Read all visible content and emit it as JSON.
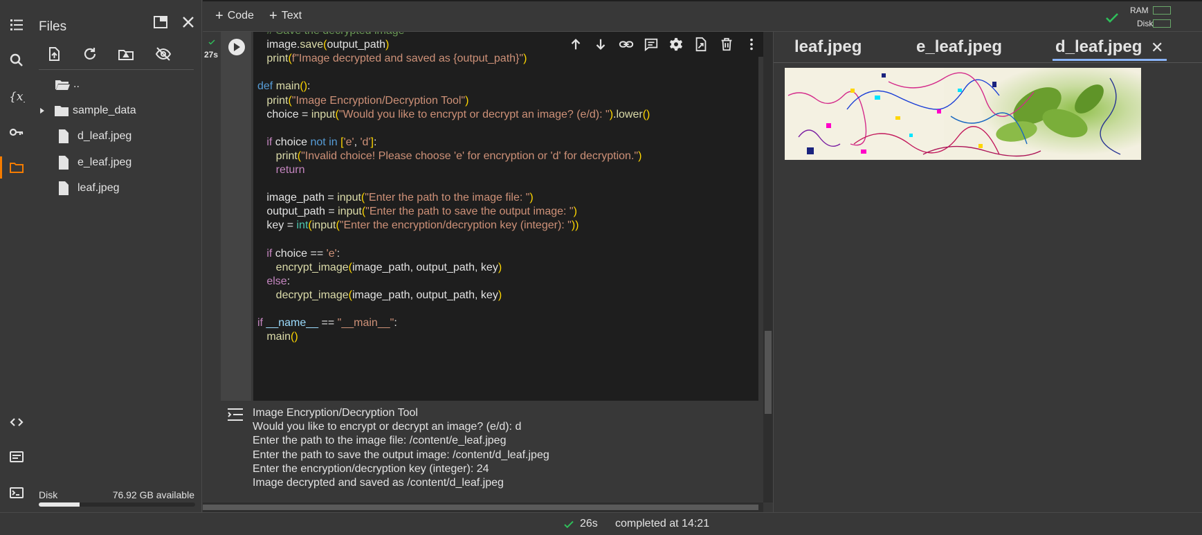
{
  "files_panel": {
    "title": "Files",
    "tree": [
      {
        "name": "..",
        "type": "parent"
      },
      {
        "name": "sample_data",
        "type": "folder"
      },
      {
        "name": "d_leaf.jpeg",
        "type": "file"
      },
      {
        "name": "e_leaf.jpeg",
        "type": "file"
      },
      {
        "name": "leaf.jpeg",
        "type": "file"
      }
    ],
    "disk_label": "Disk",
    "disk_available": "76.92 GB available",
    "disk_usage_fraction": 0.26
  },
  "toolbar": {
    "code_label": "Code",
    "text_label": "Text",
    "ram_label": "RAM",
    "disk_label": "Disk"
  },
  "cell": {
    "exec_time": "27s",
    "code_lines": [
      "    # Save the decrypted image",
      "    image.save(output_path)",
      "    print(f\"Image decrypted and saved as {output_path}\")",
      "",
      "def main():",
      "    print(\"Image Encryption/Decryption Tool\")",
      "    choice = input(\"Would you like to encrypt or decrypt an image? (e/d): \").lower()",
      "",
      "    if choice not in ['e', 'd']:",
      "        print(\"Invalid choice! Please choose 'e' for encryption or 'd' for decryption.\")",
      "        return",
      "",
      "    image_path = input(\"Enter the path to the image file: \")",
      "    output_path = input(\"Enter the path to save the output image: \")",
      "    key = int(input(\"Enter the encryption/decryption key (integer): \"))",
      "",
      "    if choice == 'e':",
      "        encrypt_image(image_path, output_path, key)",
      "    else:",
      "        decrypt_image(image_path, output_path, key)",
      "",
      "if __name__ == \"__main__\":",
      "    main()"
    ],
    "output_lines": [
      "Image Encryption/Decryption Tool",
      "Would you like to encrypt or decrypt an image? (e/d): d",
      "Enter the path to the image file: /content/e_leaf.jpeg",
      "Enter the path to save the output image: /content/d_leaf.jpeg",
      "Enter the encryption/decryption key (integer): 24",
      "Image decrypted and saved as /content/d_leaf.jpeg"
    ]
  },
  "viewer": {
    "tabs": [
      {
        "label": "leaf.jpeg"
      },
      {
        "label": "e_leaf.jpeg"
      },
      {
        "label": "d_leaf.jpeg",
        "active": true
      }
    ]
  },
  "statusbar": {
    "time": "26s",
    "completed": "completed at 14:21"
  },
  "colors": {
    "accent_orange": "#f57c00",
    "success_green": "#2fbf5a",
    "tab_underline": "#8ab4f8"
  }
}
